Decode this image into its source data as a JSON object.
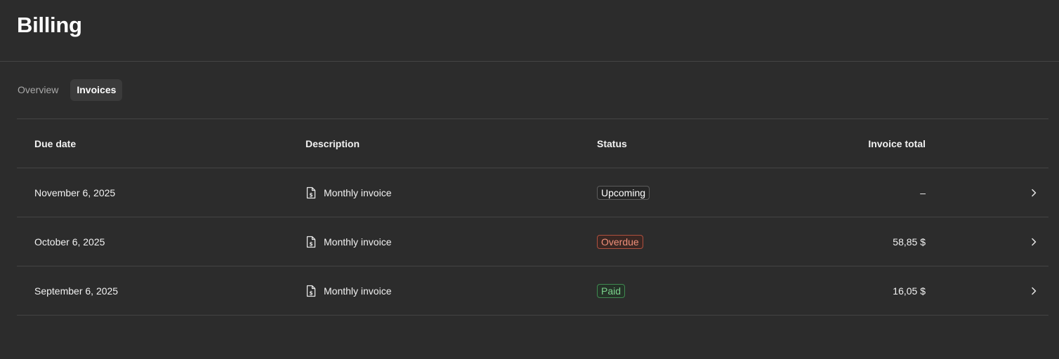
{
  "page": {
    "title": "Billing"
  },
  "tabs": [
    {
      "label": "Overview",
      "active": false
    },
    {
      "label": "Invoices",
      "active": true
    }
  ],
  "table": {
    "columns": {
      "due_date": "Due date",
      "description": "Description",
      "status": "Status",
      "total": "Invoice total"
    },
    "rows": [
      {
        "due_date": "November 6, 2025",
        "description": "Monthly invoice",
        "status": "Upcoming",
        "total": "–"
      },
      {
        "due_date": "October 6, 2025",
        "description": "Monthly invoice",
        "status": "Overdue",
        "total": "58,85 $"
      },
      {
        "due_date": "September 6, 2025",
        "description": "Monthly invoice",
        "status": "Paid",
        "total": "16,05 $"
      }
    ]
  },
  "colors": {
    "background": "#2c2c2c",
    "divider": "#444444",
    "active_tab_bg": "#3b3b3b",
    "overdue": "#f0907a",
    "paid": "#7bd28c"
  },
  "icons": {
    "description": "invoice-document-icon",
    "row_action": "chevron-right-icon"
  }
}
